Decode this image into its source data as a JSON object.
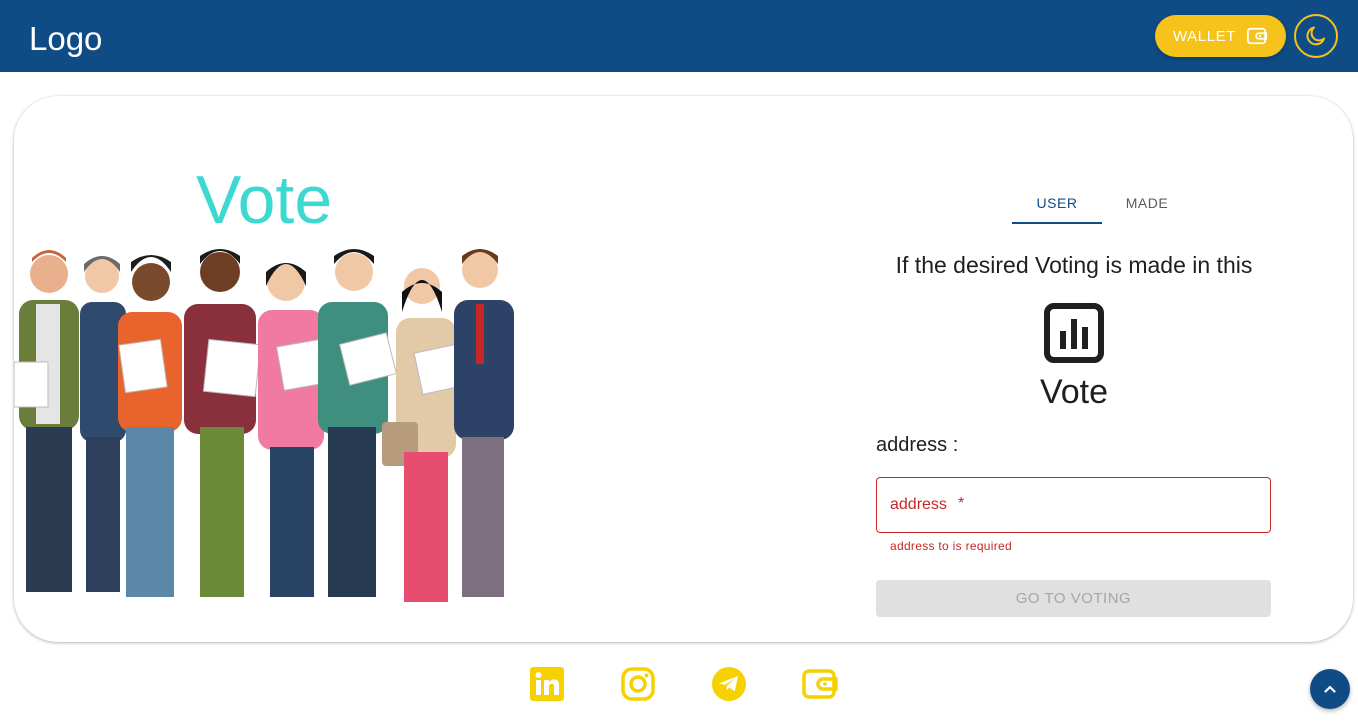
{
  "header": {
    "logo": "Logo",
    "wallet_label": "WALLET",
    "wallet_icon": "wallet-icon",
    "theme_icon": "moon-icon"
  },
  "hero": {
    "title": "Vote",
    "illustration": "people-holding-ballots-illustration"
  },
  "tabs": [
    {
      "label": "USER",
      "active": true
    },
    {
      "label": "MADE",
      "active": false
    }
  ],
  "panel": {
    "info_text": "If the desired Voting is made in this",
    "vote_icon": "poll-chart-icon",
    "vote_label": "Vote",
    "address_label": "address :",
    "address_input": {
      "placeholder": "address",
      "required_mark": "*",
      "value": "",
      "helper": "address to is required"
    },
    "go_button": "GO TO VOTING"
  },
  "footer": {
    "socials": [
      "linkedin-icon",
      "instagram-icon",
      "telegram-icon",
      "wallet-icon"
    ]
  },
  "colors": {
    "primary": "#0f4c85",
    "accent": "#f5c31c",
    "hero_title": "#3dd9d0",
    "error": "#c62828",
    "disabled": "#e0e0e0"
  }
}
